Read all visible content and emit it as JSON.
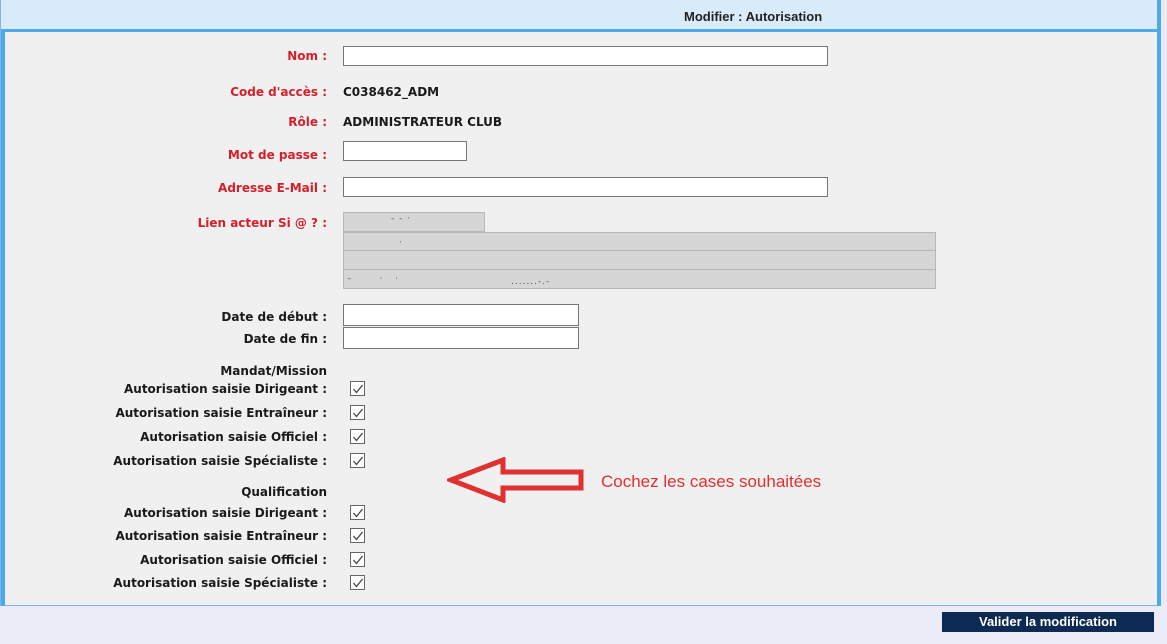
{
  "header": {
    "title": "Modifier : Autorisation"
  },
  "form": {
    "nom_label": "Nom :",
    "code_label": "Code d'accès :",
    "code_value": "C038462_ADM",
    "role_label": "Rôle :",
    "role_value": "ADMINISTRATEUR CLUB",
    "password_label": "Mot de passe :",
    "email_label": "Adresse E-Mail :",
    "lien_label": "Lien acteur Si @ ? :",
    "date_debut_label": "Date de début :",
    "date_fin_label": "Date de fin :"
  },
  "mandat": {
    "title": "Mandat/Mission",
    "items": [
      {
        "label": "Autorisation saisie Dirigeant :",
        "checked": true
      },
      {
        "label": "Autorisation saisie Entraîneur :",
        "checked": true
      },
      {
        "label": "Autorisation saisie Officiel :",
        "checked": true
      },
      {
        "label": "Autorisation saisie Spécialiste :",
        "checked": true
      }
    ]
  },
  "qualification": {
    "title": "Qualification",
    "items": [
      {
        "label": "Autorisation saisie Dirigeant :",
        "checked": true
      },
      {
        "label": "Autorisation saisie Entraîneur :",
        "checked": true
      },
      {
        "label": "Autorisation saisie Officiel :",
        "checked": true
      },
      {
        "label": "Autorisation saisie Spécialiste :",
        "checked": true
      }
    ]
  },
  "annotation": {
    "text": "Cochez les cases souhaitées",
    "color": "#e03030"
  },
  "submit": {
    "label": "Valider la modification"
  },
  "colors": {
    "accent": "#4ea8ec",
    "label_red": "#d4202a",
    "button": "#0d2a52"
  }
}
